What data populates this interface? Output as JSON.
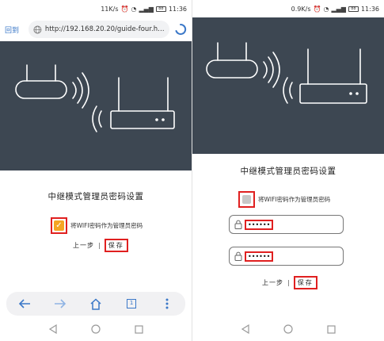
{
  "left": {
    "status": {
      "speed": "11K/s",
      "time": "11:36",
      "battery": "88"
    },
    "urlbar": {
      "back_label": "回到",
      "url": "http://192.168.20.20/guide-four.ht..."
    },
    "page": {
      "title": "中继模式管理员密码设置",
      "checkbox_label": "将WIFI密码作为管理员密码",
      "checkbox_checked": true,
      "prev_label": "上一步",
      "separator": "|",
      "save_label": "保存"
    },
    "browser_nav": {
      "tab_count": "1"
    }
  },
  "right": {
    "status": {
      "speed": "0.9K/s",
      "time": "11:36",
      "battery": "88"
    },
    "page": {
      "title": "中继模式管理员密码设置",
      "checkbox_label": "将WIFI密码作为管理员密码",
      "checkbox_checked": false,
      "password_value": "••••••",
      "confirm_password_value": "••••••",
      "prev_label": "上一步",
      "separator": "|",
      "save_label": "保存"
    }
  },
  "colors": {
    "banner": "#3d4752",
    "highlight": "#e02020",
    "checkbox_checked": "#f5a623",
    "link": "#3b78c8"
  }
}
